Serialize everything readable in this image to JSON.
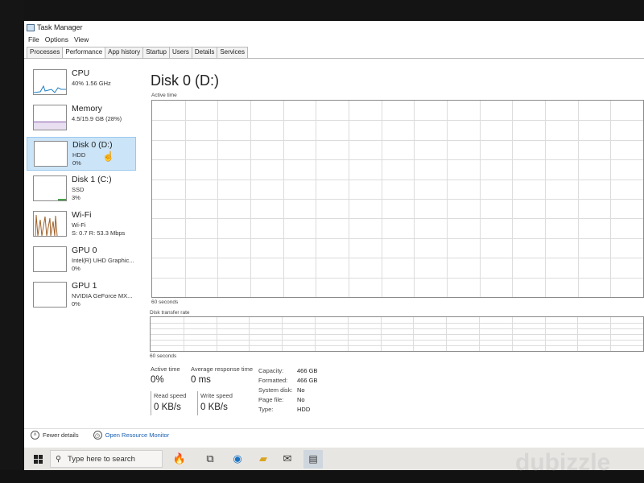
{
  "window": {
    "title": "Task Manager"
  },
  "menu": [
    "File",
    "Options",
    "View"
  ],
  "tabs": [
    "Processes",
    "Performance",
    "App history",
    "Startup",
    "Users",
    "Details",
    "Services"
  ],
  "active_tab": "Performance",
  "sidebar": [
    {
      "title": "CPU",
      "sub": "40% 1.56 GHz",
      "sub2": ""
    },
    {
      "title": "Memory",
      "sub": "4.5/15.9 GB (28%)",
      "sub2": ""
    },
    {
      "title": "Disk 0 (D:)",
      "sub": "HDD",
      "sub2": "0%"
    },
    {
      "title": "Disk 1 (C:)",
      "sub": "SSD",
      "sub2": "3%"
    },
    {
      "title": "Wi-Fi",
      "sub": "Wi-Fi",
      "sub2": "S: 0.7 R: 53.3 Mbps"
    },
    {
      "title": "GPU 0",
      "sub": "Intel(R) UHD Graphic...",
      "sub2": "0%"
    },
    {
      "title": "GPU 1",
      "sub": "NVIDIA GeForce MX...",
      "sub2": "0%"
    }
  ],
  "selected_sidebar": "Disk 0 (D:)",
  "main": {
    "title": "Disk 0 (D:)",
    "graph1_label": "Active time",
    "graph1_time": "60 seconds",
    "graph2_label": "Disk transfer rate",
    "graph2_time": "60 seconds",
    "stats": {
      "active_time_label": "Active time",
      "active_time_value": "0%",
      "avg_resp_label": "Average response time",
      "avg_resp_value": "0 ms",
      "read_label": "Read speed",
      "read_value": "0 KB/s",
      "write_label": "Write speed",
      "write_value": "0 KB/s"
    },
    "details": [
      {
        "key": "Capacity:",
        "value": "466 GB"
      },
      {
        "key": "Formatted:",
        "value": "466 GB"
      },
      {
        "key": "System disk:",
        "value": "No"
      },
      {
        "key": "Page file:",
        "value": "No"
      },
      {
        "key": "Type:",
        "value": "HDD"
      }
    ]
  },
  "footer": {
    "fewer_details": "Fewer details",
    "open_monitor": "Open Resource Monitor"
  },
  "taskbar": {
    "search_placeholder": "Type here to search"
  },
  "watermark": "dubizzle"
}
